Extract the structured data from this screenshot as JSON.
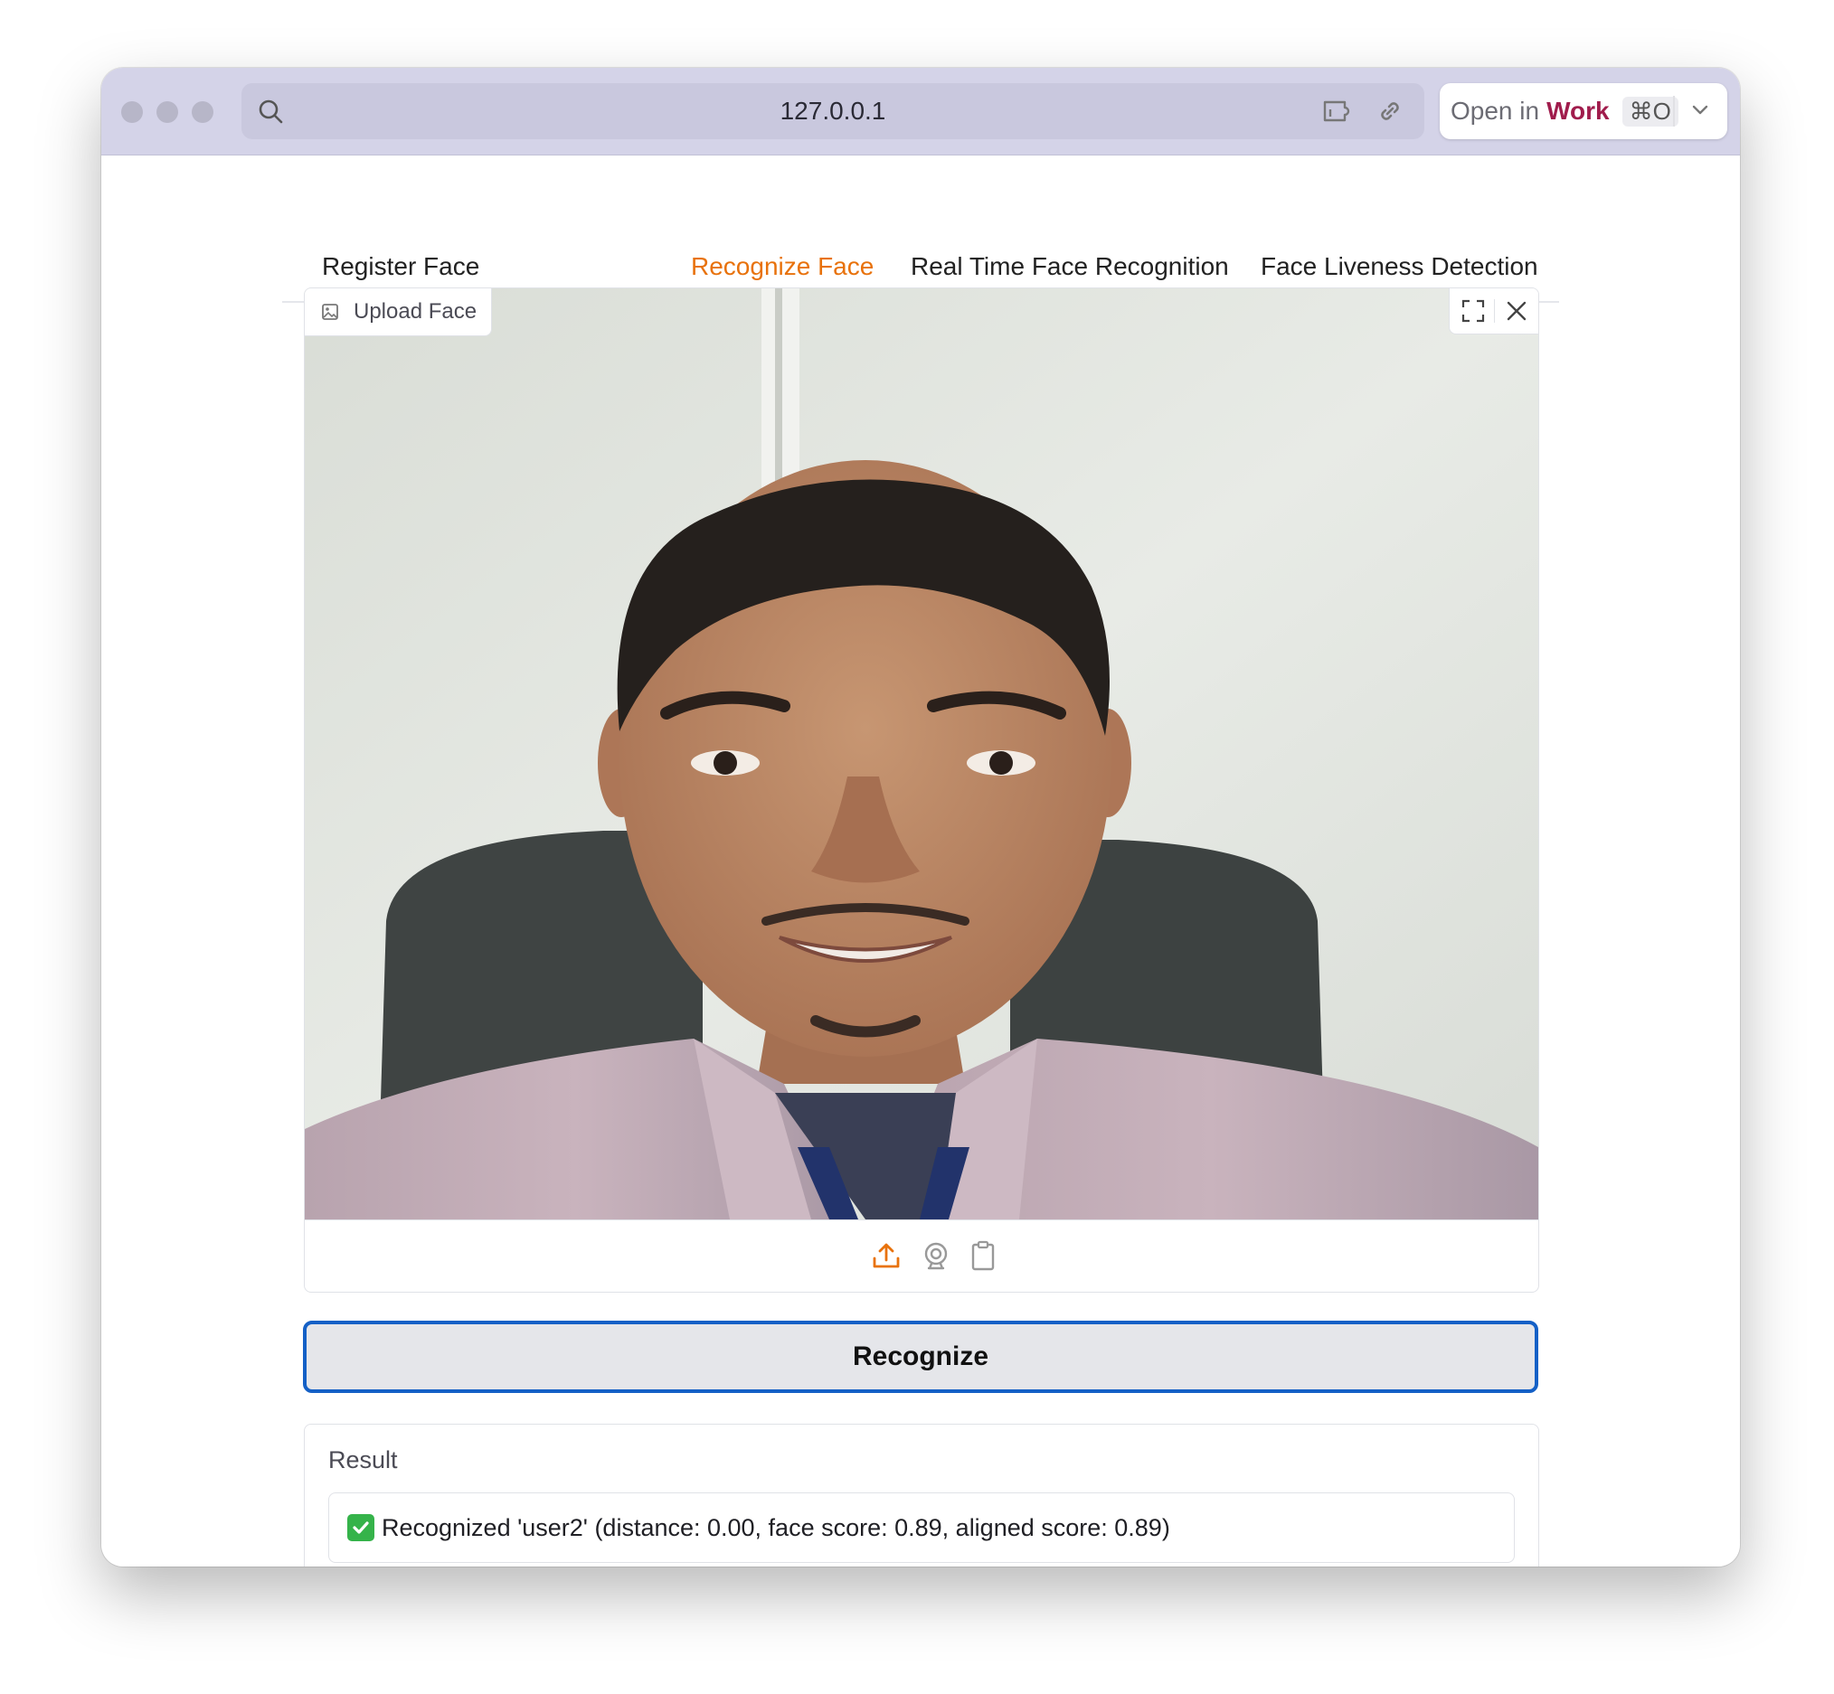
{
  "browser": {
    "url": "127.0.0.1",
    "open_in_prefix": "Open in",
    "open_in_target": "Work",
    "shortcut": "⌘O"
  },
  "tabs": [
    {
      "label": "Register Face",
      "active": false
    },
    {
      "label": "Recognize Face",
      "active": true
    },
    {
      "label": "Real Time Face Recognition",
      "active": false
    },
    {
      "label": "Face Liveness Detection",
      "active": false
    }
  ],
  "image_input": {
    "label": "Upload Face",
    "source_icons": [
      "upload-icon",
      "webcam-icon",
      "clipboard-icon"
    ],
    "tool_icons": [
      "fullscreen-icon",
      "close-icon"
    ]
  },
  "recognize_button": {
    "label": "Recognize"
  },
  "result": {
    "label": "Result",
    "text": "Recognized 'user2' (distance: 0.00, face score: 0.89, aligned score: 0.89)"
  },
  "colors": {
    "accent": "#e8720c",
    "button_border": "#1460c6",
    "work_text": "#a01c4c",
    "check_green": "#35b34a"
  }
}
